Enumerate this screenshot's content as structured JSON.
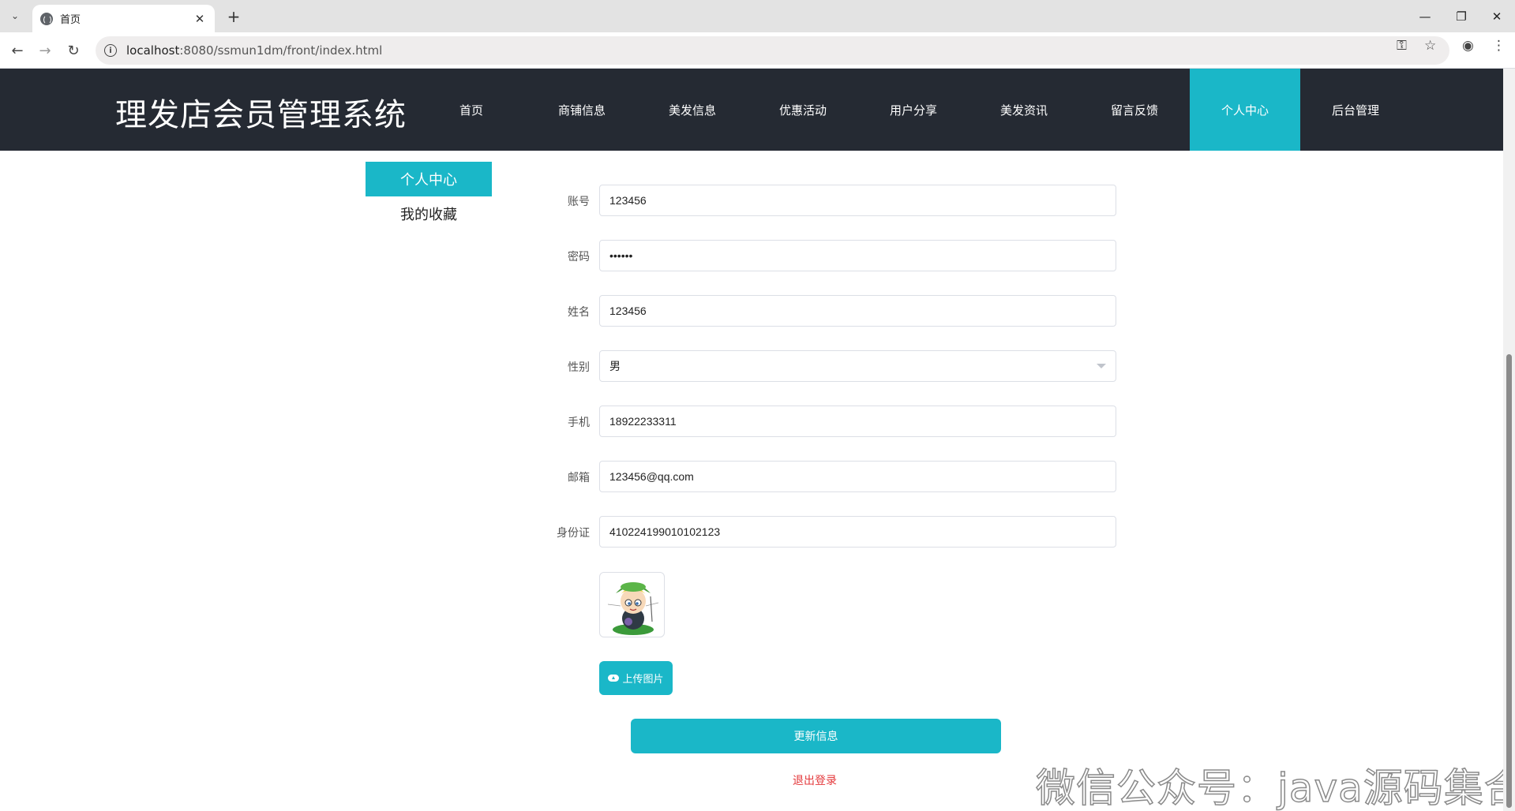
{
  "browser": {
    "tab_title": "首页",
    "url_host": "localhost",
    "url_rest": ":8080/ssmun1dm/front/index.html"
  },
  "site": {
    "title": "理发店会员管理系统",
    "nav": [
      {
        "label": "首页",
        "active": false
      },
      {
        "label": "商铺信息",
        "active": false
      },
      {
        "label": "美发信息",
        "active": false
      },
      {
        "label": "优惠活动",
        "active": false
      },
      {
        "label": "用户分享",
        "active": false
      },
      {
        "label": "美发资讯",
        "active": false
      },
      {
        "label": "留言反馈",
        "active": false
      },
      {
        "label": "个人中心",
        "active": true
      },
      {
        "label": "后台管理",
        "active": false
      }
    ],
    "accent_color": "#1ab7c8",
    "header_color": "#252a33"
  },
  "side_menu": {
    "active": "个人中心",
    "items": [
      "我的收藏"
    ]
  },
  "form": {
    "account": {
      "label": "账号",
      "value": "123456"
    },
    "password": {
      "label": "密码",
      "value": "••••••"
    },
    "name": {
      "label": "姓名",
      "value": "123456"
    },
    "gender": {
      "label": "性别",
      "value": "男"
    },
    "phone": {
      "label": "手机",
      "value": "18922233311"
    },
    "email": {
      "label": "邮箱",
      "value": "123456@qq.com"
    },
    "id_card": {
      "label": "身份证",
      "value": "410224199010102123"
    }
  },
  "buttons": {
    "upload": "上传图片",
    "update": "更新信息",
    "logout": "退出登录"
  },
  "watermark": "微信公众号：java源码集合"
}
